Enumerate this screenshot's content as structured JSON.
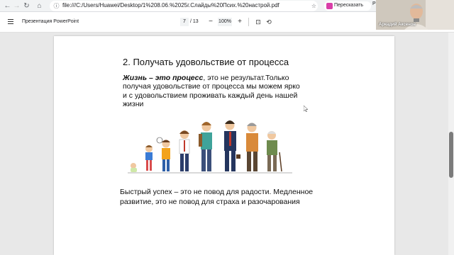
{
  "browser": {
    "url": "file:///C:/Users/Huawei/Desktop/1%208.06.%2025г.Слайды%20Псих.%20настрой.pdf",
    "retell_label": "Пересказать",
    "extra": "P"
  },
  "pdf_toolbar": {
    "title": "Презентация PowerPoint",
    "page_current": "7",
    "page_total": "/ 13",
    "zoom": "100%"
  },
  "slide": {
    "heading": "2. Получать удовольствие от процесса",
    "para_bold": "Жизнь – это процесс",
    "para_rest": ", это не результат.Только получая удовольствие от процесса мы можем ярко и с удовольствием проживать каждый день нашей жизни",
    "bottom": "Быстрый успех – это не повод для радости. Медленное развитие, это не повод для страха и разочарования"
  },
  "webcam": {
    "name": "Аркадий Аксенов"
  },
  "colors": {
    "retell_icon": "#d93ea8",
    "scroll_thumb": "#7b7b7b"
  }
}
